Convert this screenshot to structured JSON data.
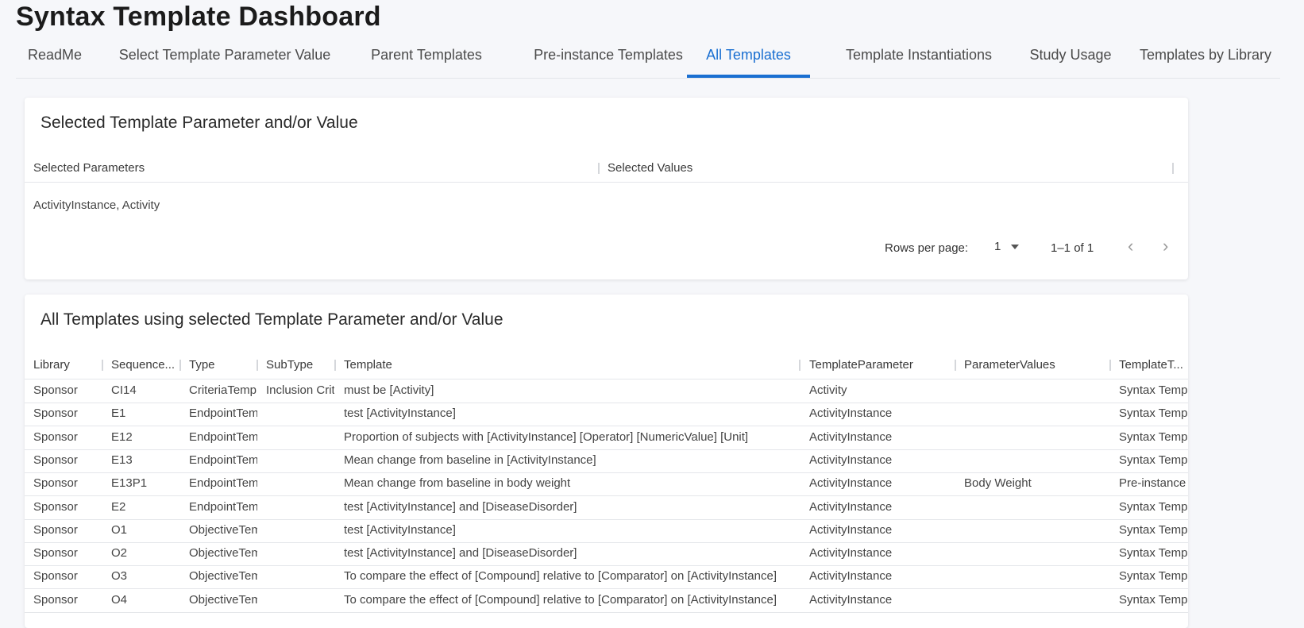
{
  "page": {
    "title": "Syntax Template Dashboard"
  },
  "tabs": [
    {
      "label": "ReadMe",
      "active": false
    },
    {
      "label": "Select Template Parameter Value",
      "active": false
    },
    {
      "label": "Parent Templates",
      "active": false
    },
    {
      "label": "Pre-instance Templates",
      "active": false
    },
    {
      "label": "All Templates",
      "active": true
    },
    {
      "label": "Template Instantiations",
      "active": false
    },
    {
      "label": "Study Usage",
      "active": false
    },
    {
      "label": "Templates by Library",
      "active": false
    }
  ],
  "selected_card": {
    "title": "Selected Template Parameter and/or Value",
    "columns": [
      "Selected Parameters",
      "Selected Values"
    ],
    "row": [
      "ActivityInstance, Activity",
      ""
    ],
    "pagination": {
      "rows_per_page_label": "Rows per page:",
      "rows_per_page_value": "1",
      "range": "1–1 of 1"
    }
  },
  "templates_card": {
    "title": "All Templates using selected Template Parameter and/or Value",
    "columns": [
      "Library",
      "Sequence...",
      "Type",
      "SubType",
      "Template",
      "TemplateParameter",
      "ParameterValues",
      "TemplateT..."
    ],
    "rows": [
      [
        "Sponsor",
        "CI14",
        "CriteriaTemplate",
        "Inclusion Criteria",
        "must be [Activity]",
        "Activity",
        "",
        "Syntax Template"
      ],
      [
        "Sponsor",
        "E1",
        "EndpointTemplate",
        "",
        "test [ActivityInstance]",
        "ActivityInstance",
        "",
        "Syntax Template"
      ],
      [
        "Sponsor",
        "E12",
        "EndpointTemplate",
        "",
        "Proportion of subjects with [ActivityInstance] [Operator] [NumericValue] [Unit]",
        "ActivityInstance",
        "",
        "Syntax Template"
      ],
      [
        "Sponsor",
        "E13",
        "EndpointTemplate",
        "",
        "Mean change from baseline in [ActivityInstance]",
        "ActivityInstance",
        "",
        "Syntax Template"
      ],
      [
        "Sponsor",
        "E13P1",
        "EndpointTemplate",
        "",
        "Mean change from baseline in body weight",
        "ActivityInstance",
        "Body Weight",
        "Pre-instance"
      ],
      [
        "Sponsor",
        "E2",
        "EndpointTemplate",
        "",
        "test [ActivityInstance] and [DiseaseDisorder]",
        "ActivityInstance",
        "",
        "Syntax Template"
      ],
      [
        "Sponsor",
        "O1",
        "ObjectiveTemplate",
        "",
        "test [ActivityInstance]",
        "ActivityInstance",
        "",
        "Syntax Template"
      ],
      [
        "Sponsor",
        "O2",
        "ObjectiveTemplate",
        "",
        "test [ActivityInstance] and [DiseaseDisorder]",
        "ActivityInstance",
        "",
        "Syntax Template"
      ],
      [
        "Sponsor",
        "O3",
        "ObjectiveTemplate",
        "",
        "To compare the effect of [Compound] relative to [Comparator] on [ActivityInstance]",
        "ActivityInstance",
        "",
        "Syntax Template"
      ],
      [
        "Sponsor",
        "O4",
        "ObjectiveTemplate",
        "",
        "To compare the effect of [Compound] relative to [Comparator] on [ActivityInstance]",
        "ActivityInstance",
        "",
        "Syntax Template"
      ]
    ]
  }
}
